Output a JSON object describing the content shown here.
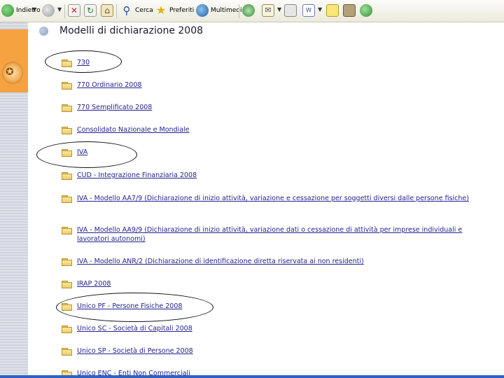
{
  "toolbar": {
    "back_label": "Indietro",
    "search_label": "Cerca",
    "favorites_label": "Preferiti",
    "multimedia_label": "Multimedia"
  },
  "page": {
    "title": "Modelli di dichiarazione 2008"
  },
  "items": [
    {
      "label": "730"
    },
    {
      "label": "770 Ordinario 2008"
    },
    {
      "label": "770 Semplificato 2008"
    },
    {
      "label": "Consolidato Nazionale e Mondiale"
    },
    {
      "label": "IVA"
    },
    {
      "label": "CUD - Integrazione Finanziaria 2008"
    },
    {
      "label": "IVA - Modello AA7/9 (Dichiarazione di inizio attività, variazione e cessazione per soggetti diversi dalle persone fisiche)"
    },
    {
      "label": "IVA - Modello AA9/9 (Dichiarazione di inizio attività, variazione dati o cessazione di attività per imprese individuali e lavoratori autonomi)"
    },
    {
      "label": "IVA - Modello ANR/2 (Dichiarazione di identificazione diretta riservata ai non residenti)"
    },
    {
      "label": "IRAP 2008"
    },
    {
      "label": "Unico PF - Persone Fisiche 2008"
    },
    {
      "label": "Unico SC - Società di Capitali 2008"
    },
    {
      "label": "Unico SP - Società di Persone 2008"
    },
    {
      "label": "Unico ENC - Enti Non Commerciali"
    }
  ]
}
